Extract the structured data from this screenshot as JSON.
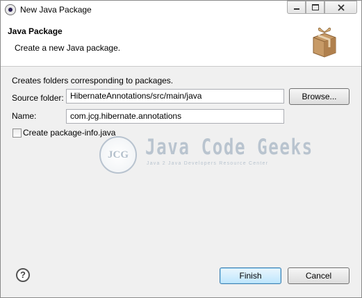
{
  "window": {
    "title": "New Java Package",
    "controls": [
      "minimize",
      "maximize",
      "close"
    ]
  },
  "banner": {
    "title": "Java Package",
    "description": "Create a new Java package.",
    "icon": "package-icon"
  },
  "form": {
    "subtitle": "Creates folders corresponding to packages.",
    "source_folder_label": "Source folder:",
    "source_folder_value": "HibernateAnnotations/src/main/java",
    "browse_label": "Browse...",
    "name_label": "Name:",
    "name_value": "com.jcg.hibernate.annotations",
    "package_info_label": "Create package-info.java",
    "package_info_checked": false
  },
  "watermark": {
    "logo_text": "JCG",
    "title": "Java Code Geeks",
    "subtitle": "Java 2 Java Developers Resource Center"
  },
  "footer": {
    "help_glyph": "?",
    "finish_label": "Finish",
    "cancel_label": "Cancel"
  },
  "colors": {
    "accent_default_button": "#bee6fd",
    "window_bg": "#f0f0f0"
  }
}
